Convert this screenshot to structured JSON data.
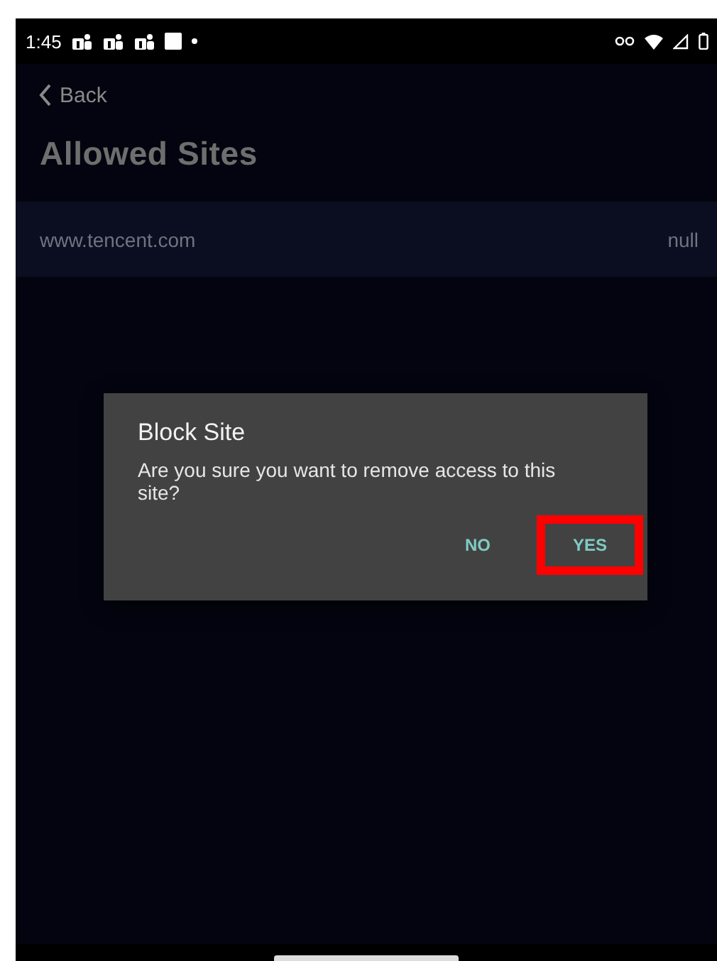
{
  "status_bar": {
    "time": "1:45"
  },
  "back": {
    "label": "Back"
  },
  "title": "Allowed Sites",
  "sites": [
    {
      "url": "www.tencent.com",
      "value": "null"
    }
  ],
  "dialog": {
    "title": "Block Site",
    "message": "Are you sure you want to remove access to this site?",
    "buttons": [
      {
        "label": "NO",
        "highlighted": false
      },
      {
        "label": "YES",
        "highlighted": true
      }
    ]
  }
}
